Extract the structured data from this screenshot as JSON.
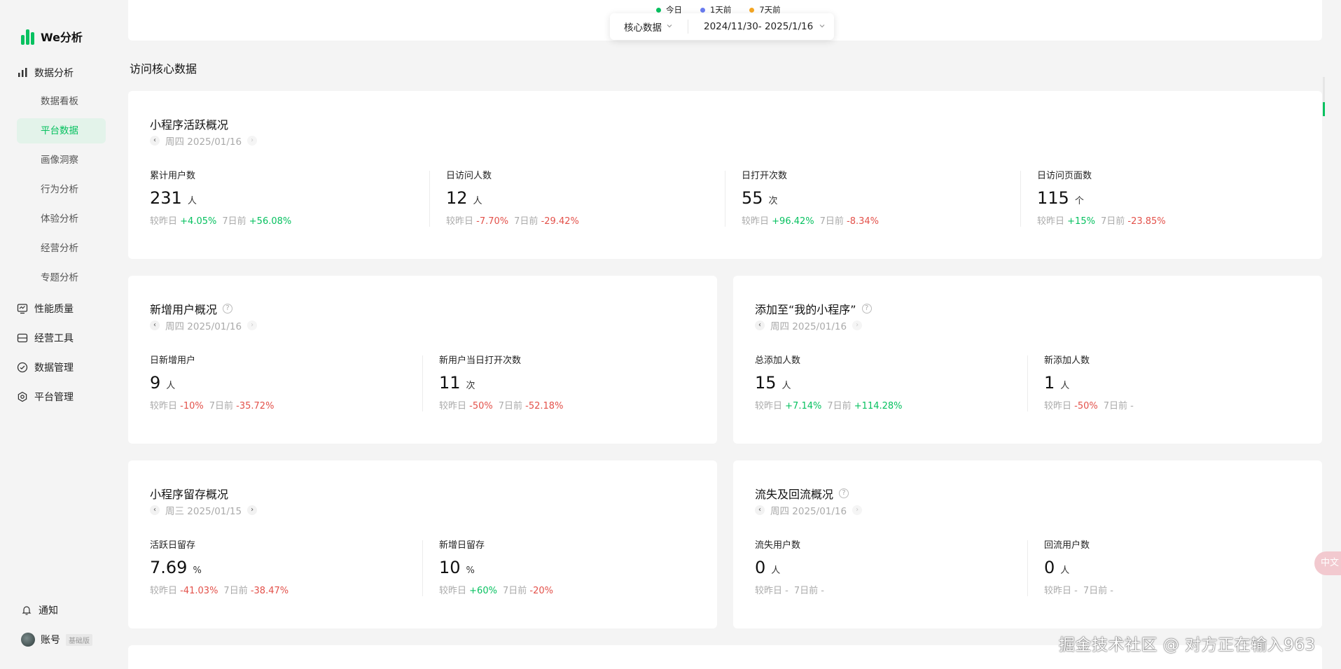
{
  "app": {
    "logo_text": "We分析",
    "brand_color": "#07c160"
  },
  "sidebar": {
    "groups": [
      {
        "label": "数据分析",
        "icon": "bar-chart-icon"
      },
      {
        "label": "性能质量",
        "icon": "monitor-icon"
      },
      {
        "label": "经营工具",
        "icon": "toolbox-icon"
      },
      {
        "label": "数据管理",
        "icon": "shield-check-icon"
      },
      {
        "label": "平台管理",
        "icon": "gear-icon"
      }
    ],
    "sub_items": [
      {
        "label": "数据看板"
      },
      {
        "label": "平台数据"
      },
      {
        "label": "画像洞察"
      },
      {
        "label": "行为分析"
      },
      {
        "label": "体验分析"
      },
      {
        "label": "经营分析"
      },
      {
        "label": "专题分析"
      }
    ],
    "notification": "通知",
    "account": "账号",
    "account_badge": "基础版"
  },
  "legend": [
    {
      "label": "今日",
      "color": "#07c160"
    },
    {
      "label": "1天前",
      "color": "#6a7cf0"
    },
    {
      "label": "7天前",
      "color": "#f5a623"
    }
  ],
  "filter": {
    "category": "核心数据",
    "date_range": "2024/11/30- 2025/1/16"
  },
  "section_title": "访问核心数据",
  "cards": {
    "active": {
      "title": "小程序活跃概况",
      "date": "周四 2025/01/16",
      "metrics": [
        {
          "label": "累计用户数",
          "value": "231",
          "unit": "人",
          "cmp_day_label": "较昨日",
          "cmp_day": "+4.05%",
          "cmp_week_label": "7日前",
          "cmp_week": "+56.08%"
        },
        {
          "label": "日访问人数",
          "value": "12",
          "unit": "人",
          "cmp_day_label": "较昨日",
          "cmp_day": "-7.70%",
          "cmp_week_label": "7日前",
          "cmp_week": "-29.42%"
        },
        {
          "label": "日打开次数",
          "value": "55",
          "unit": "次",
          "cmp_day_label": "较昨日",
          "cmp_day": "+96.42%",
          "cmp_week_label": "7日前",
          "cmp_week": "-8.34%"
        },
        {
          "label": "日访问页面数",
          "value": "115",
          "unit": "个",
          "cmp_day_label": "较昨日",
          "cmp_day": "+15%",
          "cmp_week_label": "7日前",
          "cmp_week": "-23.85%"
        }
      ]
    },
    "new_users": {
      "title": "新增用户概况",
      "date": "周四 2025/01/16",
      "metrics": [
        {
          "label": "日新增用户",
          "value": "9",
          "unit": "人",
          "cmp_day_label": "较昨日",
          "cmp_day": "-10%",
          "cmp_week_label": "7日前",
          "cmp_week": "-35.72%"
        },
        {
          "label": "新用户当日打开次数",
          "value": "11",
          "unit": "次",
          "cmp_day_label": "较昨日",
          "cmp_day": "-50%",
          "cmp_week_label": "7日前",
          "cmp_week": "-52.18%"
        }
      ]
    },
    "added": {
      "title": "添加至“我的小程序”",
      "date": "周四 2025/01/16",
      "metrics": [
        {
          "label": "总添加人数",
          "value": "15",
          "unit": "人",
          "cmp_day_label": "较昨日",
          "cmp_day": "+7.14%",
          "cmp_week_label": "7日前",
          "cmp_week": "+114.28%"
        },
        {
          "label": "新添加人数",
          "value": "1",
          "unit": "人",
          "cmp_day_label": "较昨日",
          "cmp_day": "-50%",
          "cmp_week_label": "7日前",
          "cmp_week": "-"
        }
      ]
    },
    "retention": {
      "title": "小程序留存概况",
      "date": "周三 2025/01/15",
      "metrics": [
        {
          "label": "活跃日留存",
          "value": "7.69",
          "unit": "%",
          "cmp_day_label": "较昨日",
          "cmp_day": "-41.03%",
          "cmp_week_label": "7日前",
          "cmp_week": "-38.47%"
        },
        {
          "label": "新增日留存",
          "value": "10",
          "unit": "%",
          "cmp_day_label": "较昨日",
          "cmp_day": "+60%",
          "cmp_week_label": "7日前",
          "cmp_week": "-20%"
        }
      ]
    },
    "churn": {
      "title": "流失及回流概况",
      "date": "周四 2025/01/16",
      "metrics": [
        {
          "label": "流失用户数",
          "value": "0",
          "unit": "人",
          "cmp_day_label": "较昨日",
          "cmp_day": "-",
          "cmp_week_label": "7日前",
          "cmp_week": "-"
        },
        {
          "label": "回流用户数",
          "value": "0",
          "unit": "人",
          "cmp_day_label": "较昨日",
          "cmp_day": "-",
          "cmp_week_label": "7日前",
          "cmp_week": "-"
        }
      ]
    }
  },
  "float_button": "中文",
  "watermark": "掘金技术社区 @ 对方正在输入963",
  "colors": {
    "up": "#07c160",
    "down": "#e3514a"
  }
}
